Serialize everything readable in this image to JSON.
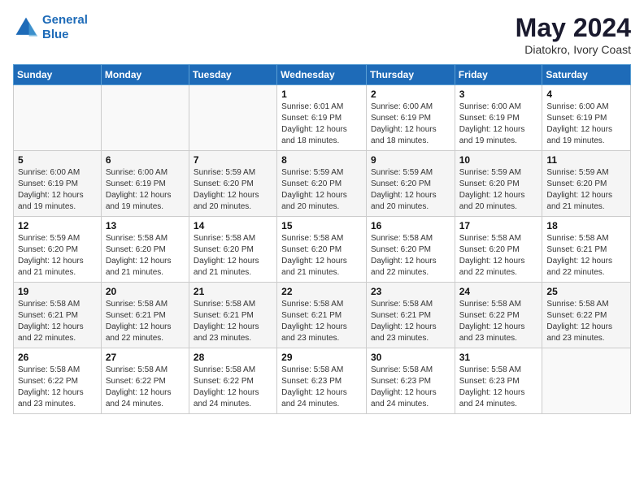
{
  "header": {
    "logo_line1": "General",
    "logo_line2": "Blue",
    "month": "May 2024",
    "location": "Diatokro, Ivory Coast"
  },
  "weekdays": [
    "Sunday",
    "Monday",
    "Tuesday",
    "Wednesday",
    "Thursday",
    "Friday",
    "Saturday"
  ],
  "weeks": [
    [
      {
        "day": "",
        "info": ""
      },
      {
        "day": "",
        "info": ""
      },
      {
        "day": "",
        "info": ""
      },
      {
        "day": "1",
        "info": "Sunrise: 6:01 AM\nSunset: 6:19 PM\nDaylight: 12 hours\nand 18 minutes."
      },
      {
        "day": "2",
        "info": "Sunrise: 6:00 AM\nSunset: 6:19 PM\nDaylight: 12 hours\nand 18 minutes."
      },
      {
        "day": "3",
        "info": "Sunrise: 6:00 AM\nSunset: 6:19 PM\nDaylight: 12 hours\nand 19 minutes."
      },
      {
        "day": "4",
        "info": "Sunrise: 6:00 AM\nSunset: 6:19 PM\nDaylight: 12 hours\nand 19 minutes."
      }
    ],
    [
      {
        "day": "5",
        "info": "Sunrise: 6:00 AM\nSunset: 6:19 PM\nDaylight: 12 hours\nand 19 minutes."
      },
      {
        "day": "6",
        "info": "Sunrise: 6:00 AM\nSunset: 6:19 PM\nDaylight: 12 hours\nand 19 minutes."
      },
      {
        "day": "7",
        "info": "Sunrise: 5:59 AM\nSunset: 6:20 PM\nDaylight: 12 hours\nand 20 minutes."
      },
      {
        "day": "8",
        "info": "Sunrise: 5:59 AM\nSunset: 6:20 PM\nDaylight: 12 hours\nand 20 minutes."
      },
      {
        "day": "9",
        "info": "Sunrise: 5:59 AM\nSunset: 6:20 PM\nDaylight: 12 hours\nand 20 minutes."
      },
      {
        "day": "10",
        "info": "Sunrise: 5:59 AM\nSunset: 6:20 PM\nDaylight: 12 hours\nand 20 minutes."
      },
      {
        "day": "11",
        "info": "Sunrise: 5:59 AM\nSunset: 6:20 PM\nDaylight: 12 hours\nand 21 minutes."
      }
    ],
    [
      {
        "day": "12",
        "info": "Sunrise: 5:59 AM\nSunset: 6:20 PM\nDaylight: 12 hours\nand 21 minutes."
      },
      {
        "day": "13",
        "info": "Sunrise: 5:58 AM\nSunset: 6:20 PM\nDaylight: 12 hours\nand 21 minutes."
      },
      {
        "day": "14",
        "info": "Sunrise: 5:58 AM\nSunset: 6:20 PM\nDaylight: 12 hours\nand 21 minutes."
      },
      {
        "day": "15",
        "info": "Sunrise: 5:58 AM\nSunset: 6:20 PM\nDaylight: 12 hours\nand 21 minutes."
      },
      {
        "day": "16",
        "info": "Sunrise: 5:58 AM\nSunset: 6:20 PM\nDaylight: 12 hours\nand 22 minutes."
      },
      {
        "day": "17",
        "info": "Sunrise: 5:58 AM\nSunset: 6:20 PM\nDaylight: 12 hours\nand 22 minutes."
      },
      {
        "day": "18",
        "info": "Sunrise: 5:58 AM\nSunset: 6:21 PM\nDaylight: 12 hours\nand 22 minutes."
      }
    ],
    [
      {
        "day": "19",
        "info": "Sunrise: 5:58 AM\nSunset: 6:21 PM\nDaylight: 12 hours\nand 22 minutes."
      },
      {
        "day": "20",
        "info": "Sunrise: 5:58 AM\nSunset: 6:21 PM\nDaylight: 12 hours\nand 22 minutes."
      },
      {
        "day": "21",
        "info": "Sunrise: 5:58 AM\nSunset: 6:21 PM\nDaylight: 12 hours\nand 23 minutes."
      },
      {
        "day": "22",
        "info": "Sunrise: 5:58 AM\nSunset: 6:21 PM\nDaylight: 12 hours\nand 23 minutes."
      },
      {
        "day": "23",
        "info": "Sunrise: 5:58 AM\nSunset: 6:21 PM\nDaylight: 12 hours\nand 23 minutes."
      },
      {
        "day": "24",
        "info": "Sunrise: 5:58 AM\nSunset: 6:22 PM\nDaylight: 12 hours\nand 23 minutes."
      },
      {
        "day": "25",
        "info": "Sunrise: 5:58 AM\nSunset: 6:22 PM\nDaylight: 12 hours\nand 23 minutes."
      }
    ],
    [
      {
        "day": "26",
        "info": "Sunrise: 5:58 AM\nSunset: 6:22 PM\nDaylight: 12 hours\nand 23 minutes."
      },
      {
        "day": "27",
        "info": "Sunrise: 5:58 AM\nSunset: 6:22 PM\nDaylight: 12 hours\nand 24 minutes."
      },
      {
        "day": "28",
        "info": "Sunrise: 5:58 AM\nSunset: 6:22 PM\nDaylight: 12 hours\nand 24 minutes."
      },
      {
        "day": "29",
        "info": "Sunrise: 5:58 AM\nSunset: 6:23 PM\nDaylight: 12 hours\nand 24 minutes."
      },
      {
        "day": "30",
        "info": "Sunrise: 5:58 AM\nSunset: 6:23 PM\nDaylight: 12 hours\nand 24 minutes."
      },
      {
        "day": "31",
        "info": "Sunrise: 5:58 AM\nSunset: 6:23 PM\nDaylight: 12 hours\nand 24 minutes."
      },
      {
        "day": "",
        "info": ""
      }
    ]
  ]
}
